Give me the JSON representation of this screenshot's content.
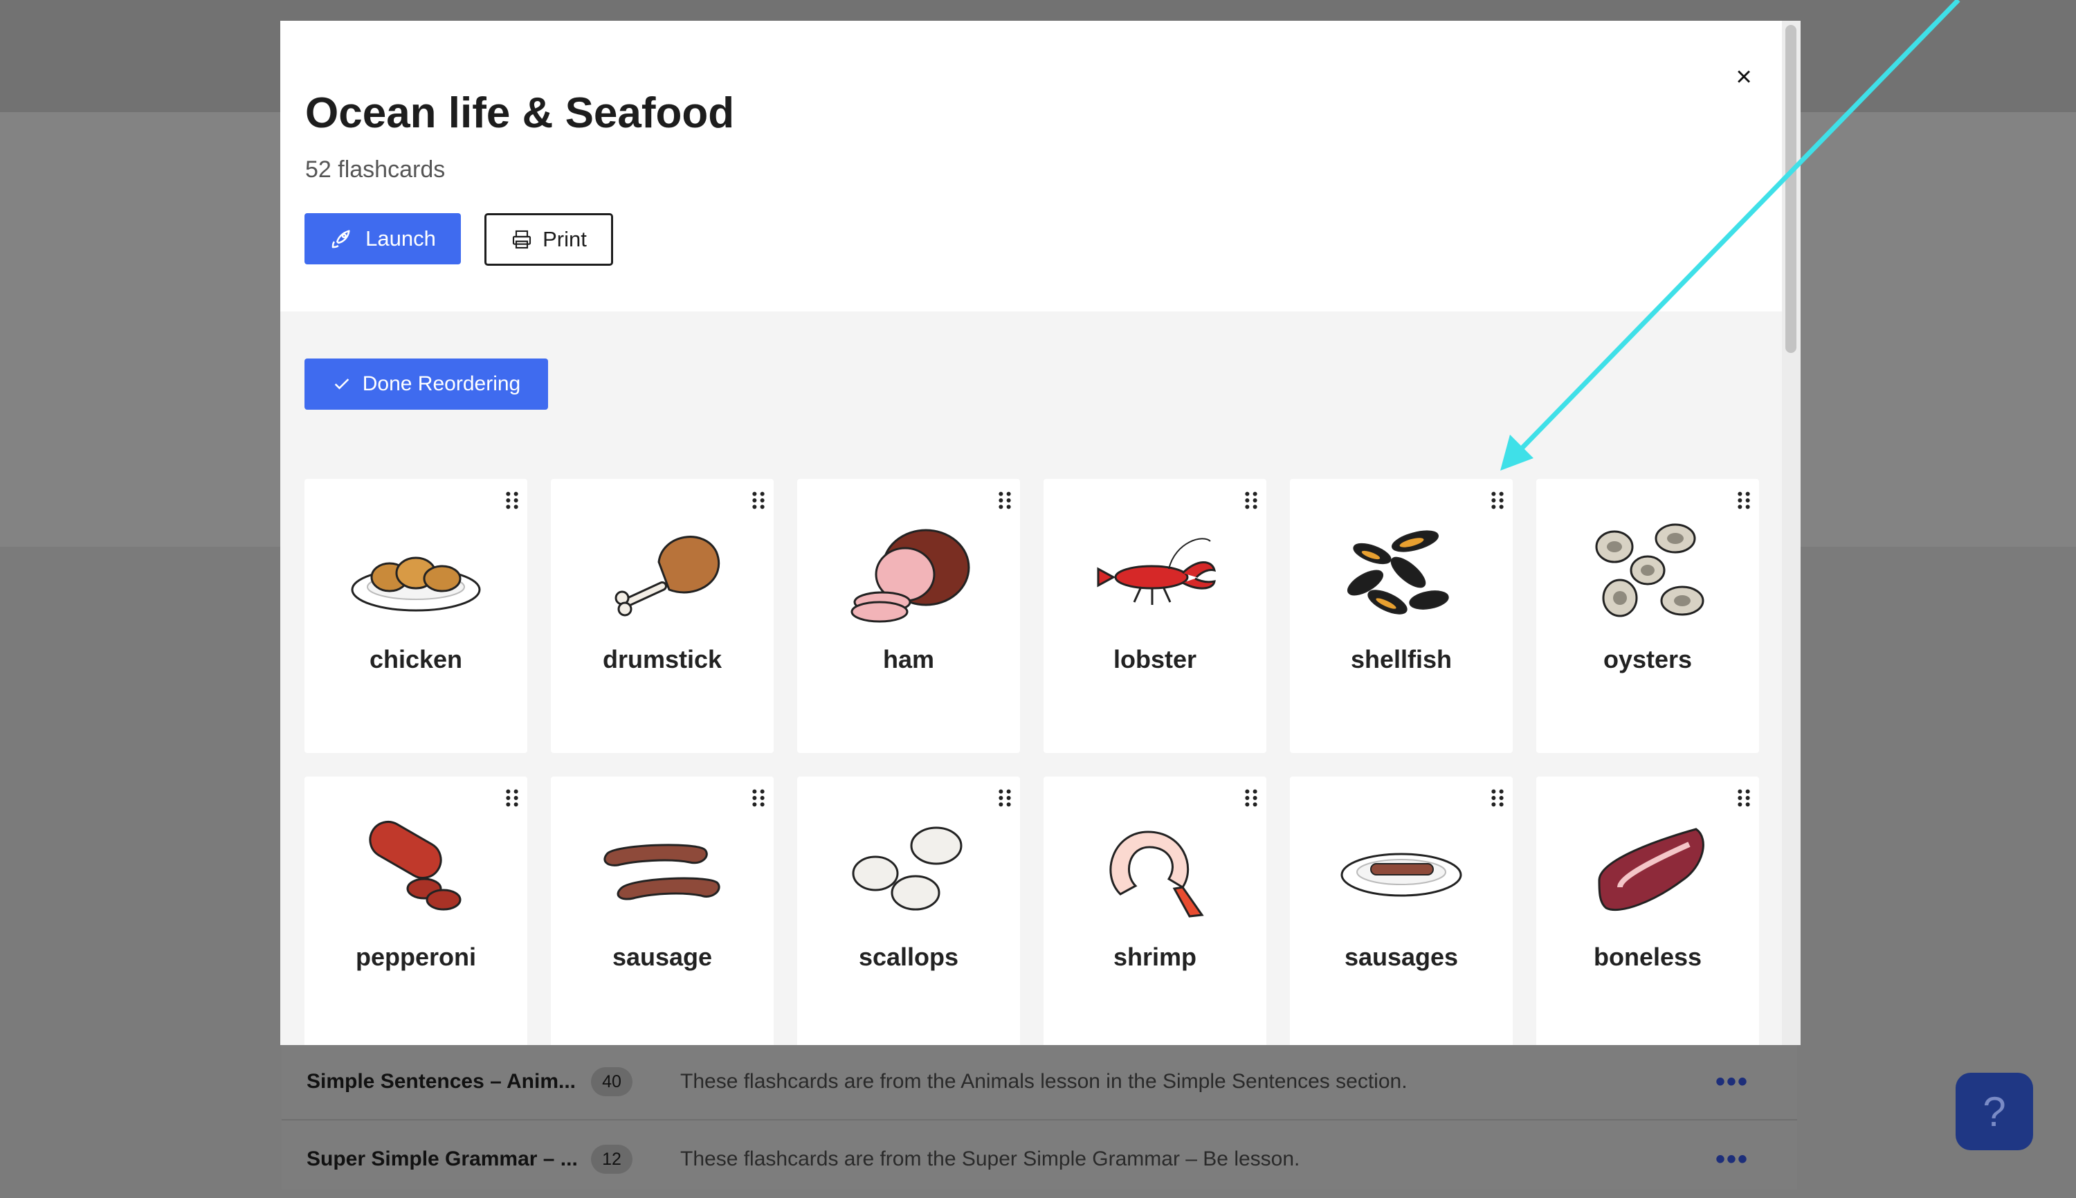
{
  "modal": {
    "title": "Ocean life & Seafood",
    "subtitle": "52 flashcards",
    "close_glyph": "×",
    "launch_label": "Launch",
    "print_label": "Print",
    "done_label": "Done Reordering"
  },
  "cards": [
    {
      "label": "chicken",
      "icon": "fried-chicken-plate"
    },
    {
      "label": "drumstick",
      "icon": "drumstick"
    },
    {
      "label": "ham",
      "icon": "ham"
    },
    {
      "label": "lobster",
      "icon": "lobster"
    },
    {
      "label": "shellfish",
      "icon": "mussels"
    },
    {
      "label": "oysters",
      "icon": "oysters"
    },
    {
      "label": "pepperoni",
      "icon": "pepperoni"
    },
    {
      "label": "sausage",
      "icon": "sausage"
    },
    {
      "label": "scallops",
      "icon": "scallops"
    },
    {
      "label": "shrimp",
      "icon": "shrimp"
    },
    {
      "label": "sausages",
      "icon": "sausages-plate"
    },
    {
      "label": "boneless",
      "icon": "boneless-meat"
    }
  ],
  "background_rows": [
    {
      "title": "Simple Sentences – Anim...",
      "count": "40",
      "description": "These flashcards are from the Animals lesson in the Simple Sentences section.",
      "more": "•••"
    },
    {
      "title": "Super Simple Grammar – ...",
      "count": "12",
      "description": "These flashcards are from the Super Simple Grammar – Be lesson.",
      "more": "•••"
    }
  ],
  "help_glyph": "?",
  "colors": {
    "primary": "#3f6bef",
    "annotation_arrow": "#3fe0e8"
  }
}
